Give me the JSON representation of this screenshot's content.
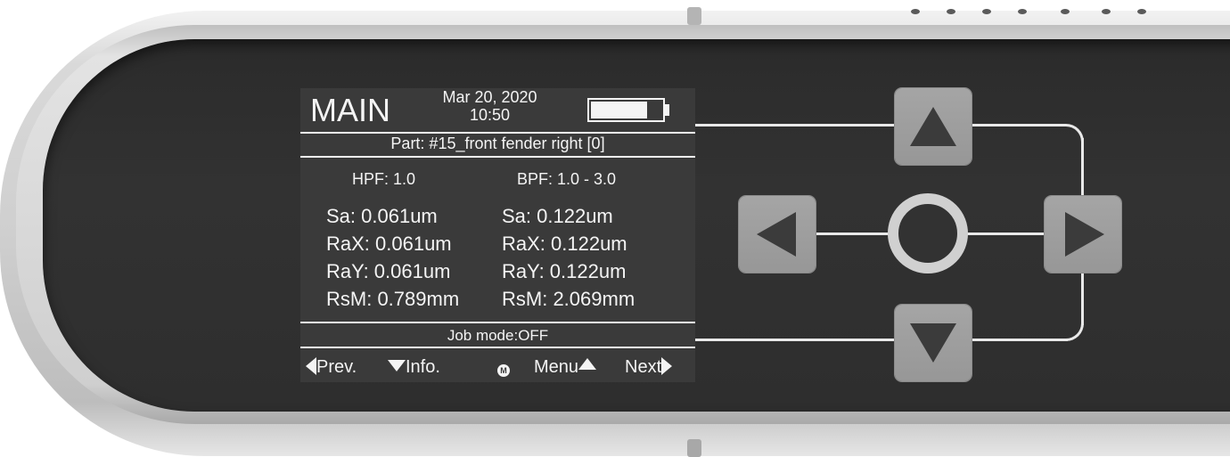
{
  "screen": {
    "title": "MAIN",
    "date": "Mar 20, 2020",
    "time": "10:50",
    "battery_level": 0.8,
    "part_label": "Part: #15_front fender right [0]",
    "filters": {
      "left": "HPF: 1.0",
      "right": "BPF: 1.0 - 3.0"
    },
    "measurements_left": [
      "Sa: 0.061um",
      "RaX: 0.061um",
      "RaY: 0.061um",
      "RsM: 0.789mm"
    ],
    "measurements_right": [
      "Sa: 0.122um",
      "RaX: 0.122um",
      "RaY: 0.122um",
      "RsM: 2.069mm"
    ],
    "job_mode": "Job mode:OFF",
    "footer": {
      "prev": "Prev.",
      "info": "Info.",
      "m_icon": "M",
      "menu": "Menu",
      "next": "Next"
    }
  },
  "controls": {
    "up": "up-arrow-icon",
    "down": "down-arrow-icon",
    "left": "left-arrow-icon",
    "right": "right-arrow-icon",
    "ok": "circle-icon"
  },
  "colors": {
    "screen_bg": "#3a3a3a",
    "screen_fg": "#f4f4f4",
    "panel": "#2e2e2e",
    "button": "#a0a0a0",
    "housing": "#d0d0d0"
  }
}
